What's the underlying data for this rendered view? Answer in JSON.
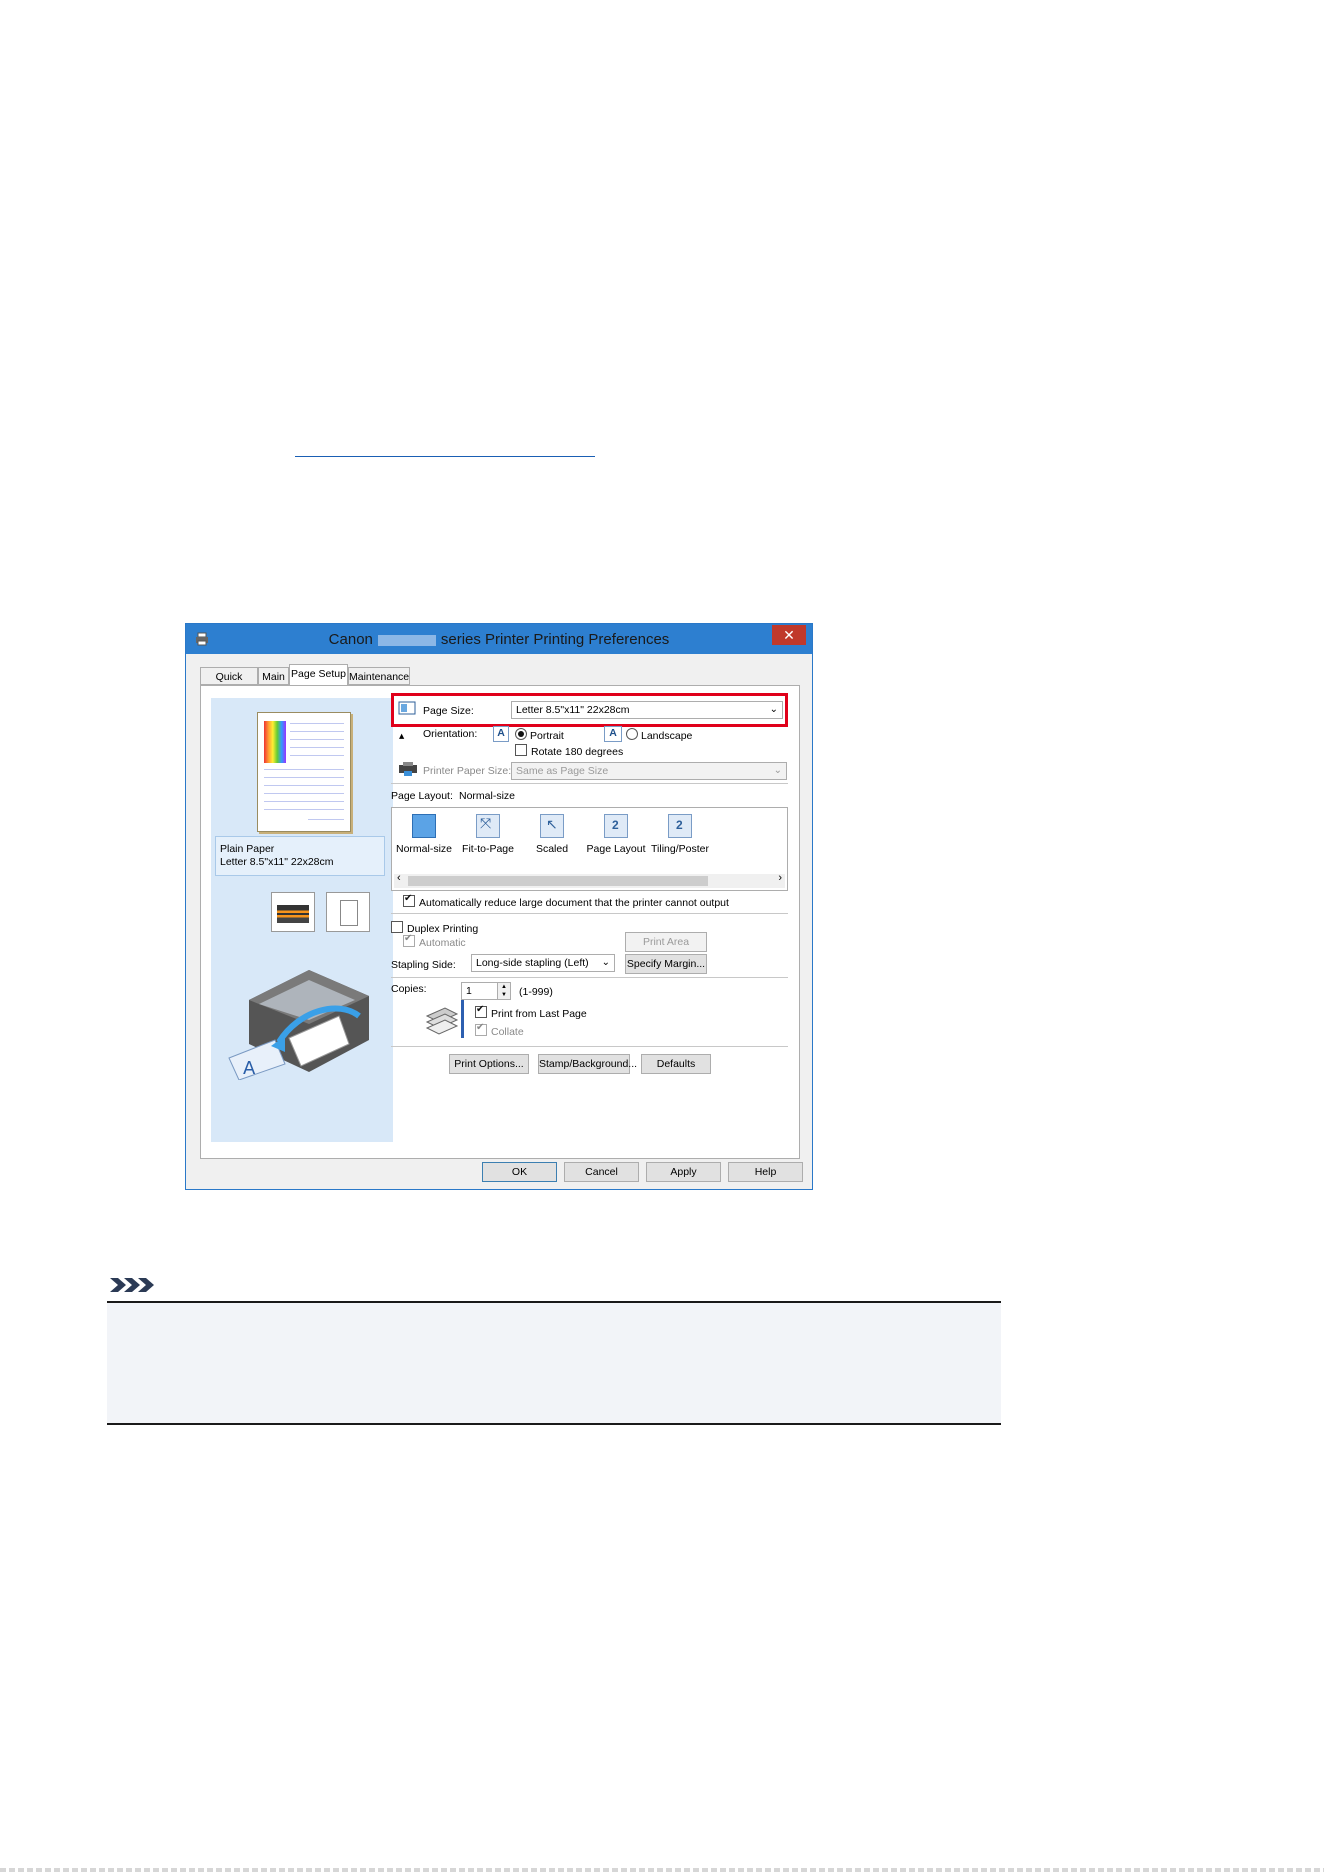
{
  "dialog": {
    "title_left": "Canon",
    "title_right": "series Printer Printing Preferences",
    "close_label": "✕",
    "tabs": [
      {
        "label": "Quick Setup"
      },
      {
        "label": "Main"
      },
      {
        "label": "Page Setup"
      },
      {
        "label": "Maintenance"
      }
    ],
    "preview": {
      "paper_type": "Plain Paper",
      "paper_size": "Letter 8.5\"x11\" 22x28cm"
    },
    "page_size": {
      "label": "Page Size:",
      "value": "Letter 8.5\"x11\" 22x28cm"
    },
    "orientation": {
      "label": "Orientation:",
      "portrait": "Portrait",
      "landscape": "Landscape",
      "rotate": "Rotate 180 degrees",
      "selected": "Portrait"
    },
    "printer_paper_size": {
      "label": "Printer Paper Size:",
      "value": "Same as Page Size"
    },
    "page_layout": {
      "label": "Page Layout:",
      "value": "Normal-size",
      "items": [
        {
          "label": "Normal-size"
        },
        {
          "label": "Fit-to-Page"
        },
        {
          "label": "Scaled"
        },
        {
          "label": "Page Layout"
        },
        {
          "label": "Tiling/Poster"
        }
      ]
    },
    "auto_reduce": "Automatically reduce large document that the printer cannot output",
    "duplex": {
      "label": "Duplex Printing",
      "automatic": "Automatic",
      "print_area_button": "Print Area Setup..."
    },
    "stapling": {
      "label": "Stapling Side:",
      "value": "Long-side stapling (Left)",
      "margin_button": "Specify Margin..."
    },
    "copies": {
      "label": "Copies:",
      "value": "1",
      "range": "(1-999)",
      "print_last": "Print from Last Page",
      "collate": "Collate"
    },
    "buttons": {
      "print_options": "Print Options...",
      "stamp_background": "Stamp/Background...",
      "defaults": "Defaults",
      "ok": "OK",
      "cancel": "Cancel",
      "apply": "Apply",
      "help": "Help"
    }
  },
  "colors": {
    "titlebar": "#2d7fd0",
    "highlight": "#e0001a",
    "preview_bg": "#d8e8f8",
    "link": "#1a5fb4"
  }
}
